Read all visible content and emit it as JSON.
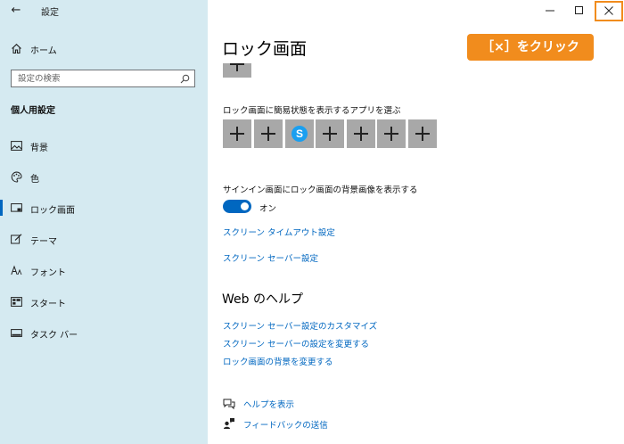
{
  "window": {
    "app_title": "設定",
    "back_glyph": "←",
    "minimize_glyph": "—",
    "maximize_glyph": "☐",
    "close_glyph": "✕"
  },
  "sidebar": {
    "home_label": "ホーム",
    "search_placeholder": "設定の検索",
    "section_title": "個人用設定",
    "items": [
      {
        "label": "背景",
        "icon": "picture-icon"
      },
      {
        "label": "色",
        "icon": "palette-icon"
      },
      {
        "label": "ロック画面",
        "icon": "lock-screen-icon",
        "selected": true
      },
      {
        "label": "テーマ",
        "icon": "theme-icon"
      },
      {
        "label": "フォント",
        "icon": "font-icon"
      },
      {
        "label": "スタート",
        "icon": "start-icon"
      },
      {
        "label": "タスク バー",
        "icon": "taskbar-icon"
      }
    ]
  },
  "main": {
    "page_title": "ロック画面",
    "quick_status_label": "ロック画面に簡易状態を表示するアプリを選ぶ",
    "quick_status_tiles": [
      "plus",
      "plus",
      "skype",
      "plus",
      "plus",
      "plus",
      "plus"
    ],
    "skype_letter": "S",
    "signin_bg_label": "サインイン画面にロック画面の背景画像を表示する",
    "toggle_state_label": "オン",
    "toggle_on": true,
    "screen_timeout_link": "スクリーン タイムアウト設定",
    "screen_saver_link": "スクリーン セーバー設定",
    "web_help_title": "Web のヘルプ",
    "help_links": [
      "スクリーン セーバー設定のカスタマイズ",
      "スクリーン セーバーの設定を変更する",
      "ロック画面の背景を変更する"
    ],
    "show_help_link": "ヘルプを表示",
    "feedback_link": "フィードバックの送信"
  },
  "annotation": {
    "callout_text": "［×］をクリック",
    "color": "#f18c1d"
  },
  "colors": {
    "sidebar_bg": "#d5eaf1",
    "accent": "#0067c0",
    "tile_bg": "#a8a8a8",
    "skype": "#1a9ff0"
  }
}
